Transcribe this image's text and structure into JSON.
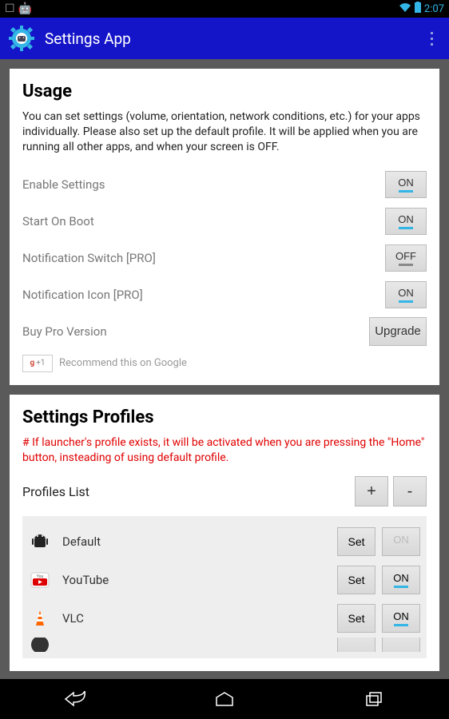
{
  "status": {
    "time": "2:07"
  },
  "app": {
    "title": "Settings App"
  },
  "usage": {
    "heading": "Usage",
    "description": "You can set settings (volume, orientation, network conditions, etc.) for your apps individually. Please also set up the default profile. It will be applied when you are running all other apps, and when your screen is OFF.",
    "rows": [
      {
        "label": "Enable Settings",
        "value": "ON"
      },
      {
        "label": "Start On Boot",
        "value": "ON"
      },
      {
        "label": "Notification Switch [PRO]",
        "value": "OFF"
      },
      {
        "label": "Notification Icon [PRO]",
        "value": "ON"
      }
    ],
    "buy_label": "Buy Pro Version",
    "upgrade_label": "Upgrade",
    "recommend_text": "Recommend this on Google",
    "gplus_badge": "+1"
  },
  "profiles": {
    "heading": "Settings Profiles",
    "warning": "# If launcher's profile exists, it will be activated when you are pressing the \"Home\" button, insteading of using default profile.",
    "list_label": "Profiles List",
    "add_label": "+",
    "remove_label": "-",
    "set_label": "Set",
    "items": [
      {
        "name": "Default",
        "toggle": "ON",
        "toggle_enabled": false
      },
      {
        "name": "YouTube",
        "toggle": "ON",
        "toggle_enabled": true
      },
      {
        "name": "VLC",
        "toggle": "ON",
        "toggle_enabled": true
      }
    ]
  }
}
